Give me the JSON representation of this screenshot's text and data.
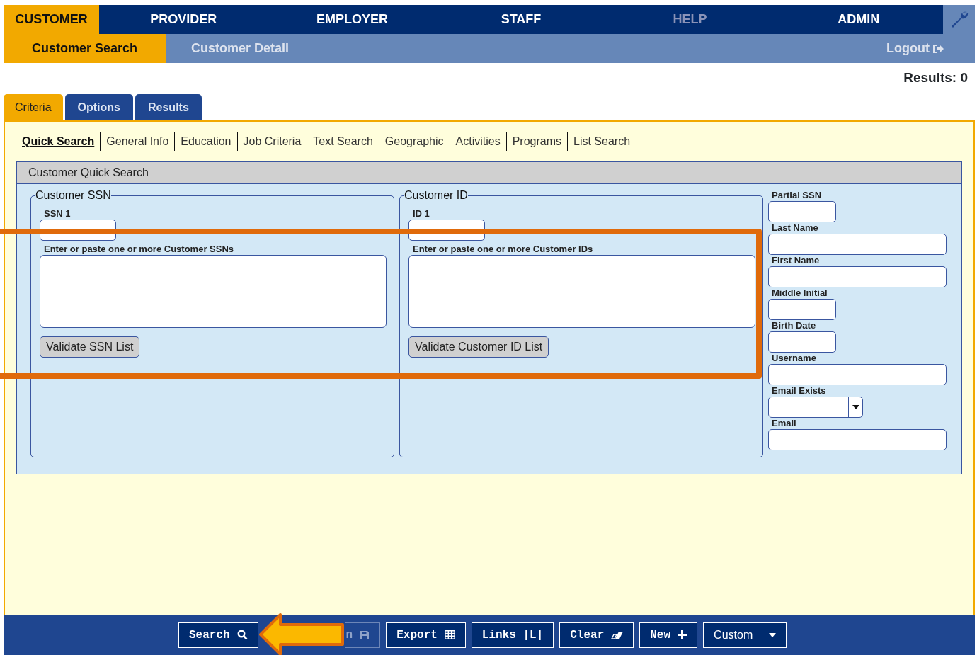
{
  "top_nav": [
    {
      "label": "CUSTOMER",
      "selected": true,
      "disabled": false
    },
    {
      "label": "PROVIDER",
      "selected": false,
      "disabled": false
    },
    {
      "label": "EMPLOYER",
      "selected": false,
      "disabled": false
    },
    {
      "label": "STAFF",
      "selected": false,
      "disabled": false
    },
    {
      "label": "HELP",
      "selected": false,
      "disabled": true
    },
    {
      "label": "ADMIN",
      "selected": false,
      "disabled": false
    }
  ],
  "sub_nav": [
    {
      "label": "Customer Search",
      "selected": true
    },
    {
      "label": "Customer Detail",
      "selected": false
    }
  ],
  "logout": "Logout",
  "results": "Results: 0",
  "tabs": [
    {
      "label": "Criteria",
      "selected": true
    },
    {
      "label": "Options",
      "selected": false
    },
    {
      "label": "Results",
      "selected": false
    }
  ],
  "sub_tabs": [
    {
      "label": "Quick Search",
      "selected": true
    },
    {
      "label": "General Info",
      "selected": false
    },
    {
      "label": "Education",
      "selected": false
    },
    {
      "label": "Job Criteria",
      "selected": false
    },
    {
      "label": "Text Search",
      "selected": false
    },
    {
      "label": "Geographic",
      "selected": false
    },
    {
      "label": "Activities",
      "selected": false
    },
    {
      "label": "Programs",
      "selected": false
    },
    {
      "label": "List Search",
      "selected": false
    }
  ],
  "panel": {
    "title": "Customer Quick Search",
    "groups": [
      {
        "legend": "Customer SSN",
        "field_label": "SSN 1",
        "list_label": "Enter or paste one or more Customer SSNs",
        "button": "Validate SSN List"
      },
      {
        "legend": "Customer ID",
        "field_label": "ID 1",
        "list_label": "Enter or paste one or more Customer IDs",
        "button": "Validate Customer ID List"
      }
    ],
    "fields": [
      {
        "label": "Partial SSN",
        "kind": "short"
      },
      {
        "label": "Last Name",
        "kind": "wide"
      },
      {
        "label": "First Name",
        "kind": "wide"
      },
      {
        "label": "Middle Initial",
        "kind": "short"
      },
      {
        "label": "Birth Date",
        "kind": "short"
      },
      {
        "label": "Username",
        "kind": "wide"
      },
      {
        "label": "Email Exists",
        "kind": "select"
      },
      {
        "label": "Email",
        "kind": "wide"
      }
    ]
  },
  "footer_buttons": [
    {
      "label": "Search",
      "kind": "search",
      "disabled": false
    },
    {
      "label": "n",
      "kind": "save",
      "disabled": true
    },
    {
      "label": "Export",
      "kind": "export",
      "disabled": false
    },
    {
      "label": "Links |L|",
      "kind": "links",
      "disabled": false
    },
    {
      "label": "Clear",
      "kind": "clear",
      "disabled": false
    },
    {
      "label": "New",
      "kind": "new",
      "disabled": false
    },
    {
      "label": "Custom",
      "kind": "custom",
      "disabled": false
    }
  ]
}
